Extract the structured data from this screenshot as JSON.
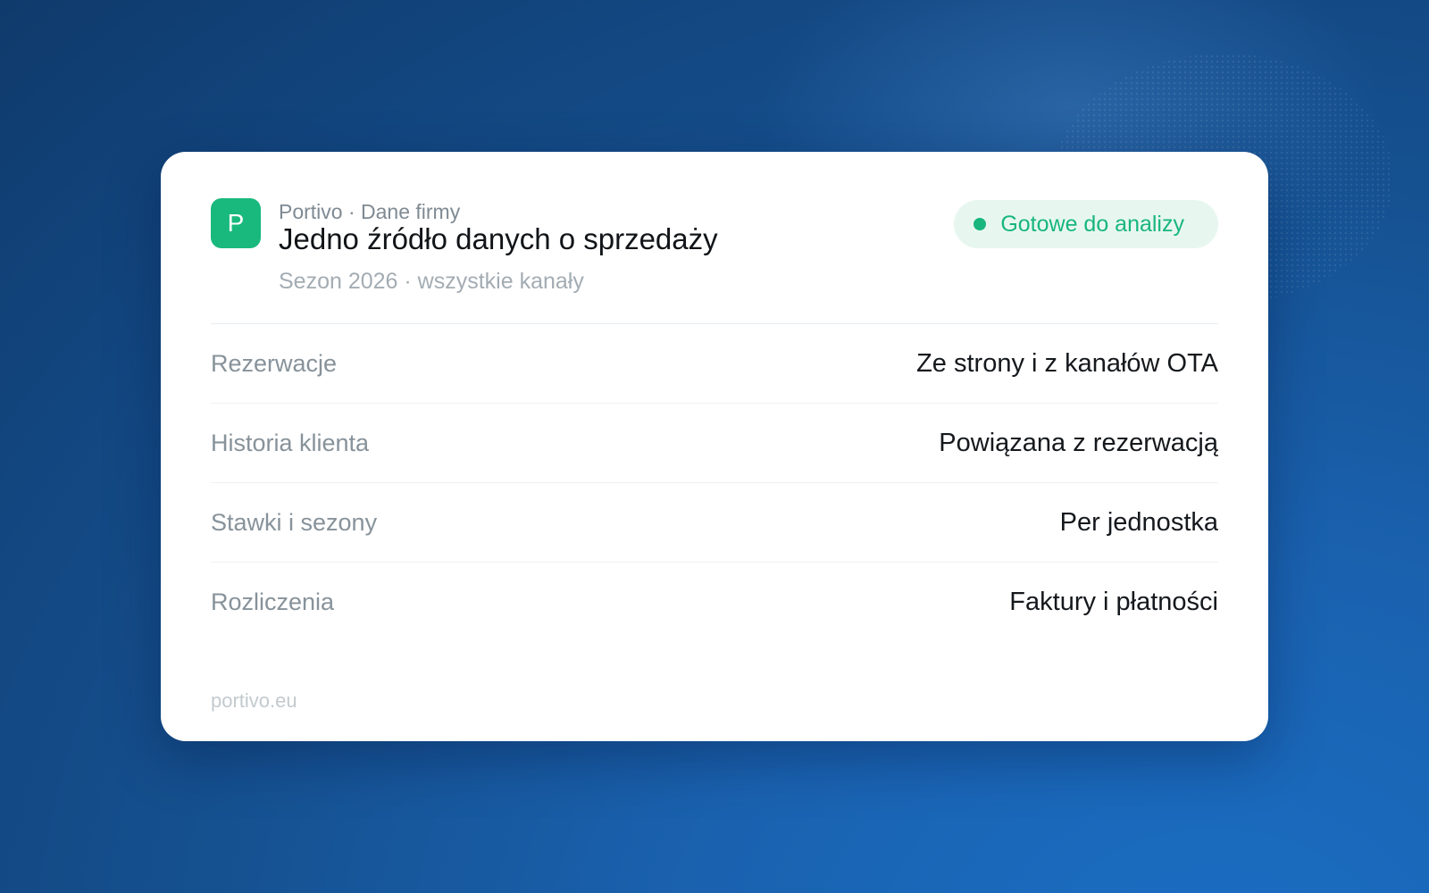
{
  "brand": {
    "logo_letter": "P",
    "eyebrow": "Portivo · Dane firmy",
    "colors": {
      "brand_green": "#19b97e",
      "status_bg": "#e7f7f0"
    }
  },
  "header": {
    "title": "Jedno źródło danych o sprzedaży",
    "subtitle": "Sezon 2026 · wszystkie kanały",
    "status": "Gotowe do analizy"
  },
  "rows": [
    {
      "label": "Rezerwacje",
      "value": "Ze strony i z kanałów OTA"
    },
    {
      "label": "Historia klienta",
      "value": "Powiązana z rezerwacją"
    },
    {
      "label": "Stawki i sezony",
      "value": "Per jednostka"
    },
    {
      "label": "Rozliczenia",
      "value": "Faktury i płatności"
    }
  ],
  "footer": {
    "link": "portivo.eu"
  }
}
